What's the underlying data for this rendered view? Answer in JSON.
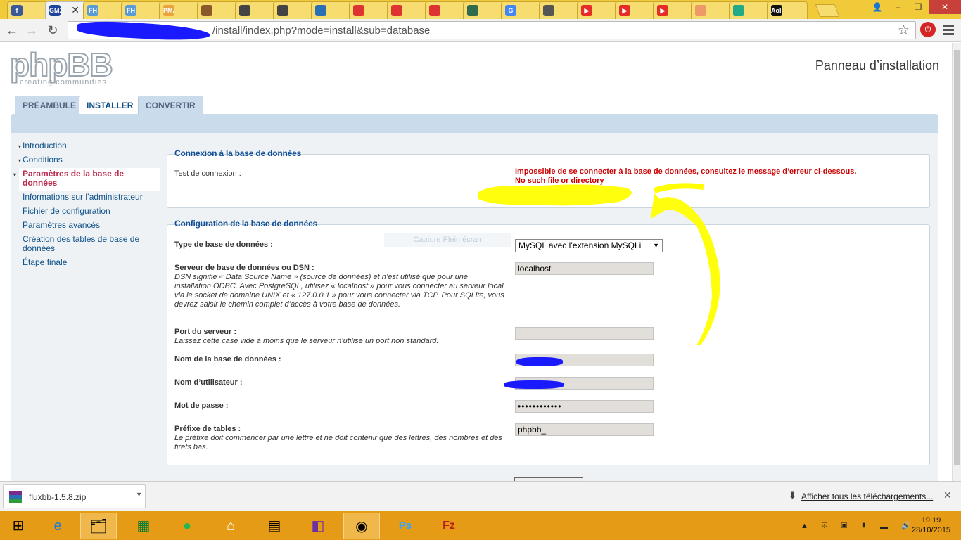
{
  "browser": {
    "tabs": [
      {
        "icon": "facebook-icon",
        "text": "f",
        "color": "#3b5998"
      },
      {
        "icon": "gmx-icon",
        "text": "GMX",
        "color": "#1c449b",
        "active": true
      },
      {
        "icon": "fh-icon",
        "text": "FH",
        "color": "#5b9bd5"
      },
      {
        "icon": "fh-icon",
        "text": "FH",
        "color": "#5b9bd5"
      },
      {
        "icon": "pma-icon",
        "text": "PMA",
        "color": "#e8a33d"
      },
      {
        "icon": "bird-icon",
        "text": "",
        "color": "#8b5a2b"
      },
      {
        "icon": "swirl-icon",
        "text": "",
        "color": "#444"
      },
      {
        "icon": "swirl-icon",
        "text": "",
        "color": "#444"
      },
      {
        "icon": "globe-icon",
        "text": "",
        "color": "#2a6fb6"
      },
      {
        "icon": "magnet-icon",
        "text": "",
        "color": "#d33"
      },
      {
        "icon": "magnet-icon",
        "text": "",
        "color": "#d33"
      },
      {
        "icon": "magnet-icon",
        "text": "",
        "color": "#d33"
      },
      {
        "icon": "camera-icon",
        "text": "",
        "color": "#2e6b4f"
      },
      {
        "icon": "google-icon",
        "text": "G",
        "color": "#4285f4"
      },
      {
        "icon": "wolf-icon",
        "text": "",
        "color": "#555"
      },
      {
        "icon": "youtube-icon",
        "text": "▶",
        "color": "#e52d27"
      },
      {
        "icon": "youtube-icon",
        "text": "▶",
        "color": "#e52d27"
      },
      {
        "icon": "youtube-icon",
        "text": "▶",
        "color": "#e52d27"
      },
      {
        "icon": "rainbow-icon",
        "text": "",
        "color": "#e96"
      },
      {
        "icon": "dial-icon",
        "text": "",
        "color": "#2a8"
      },
      {
        "icon": "aol-icon",
        "text": "Aol.",
        "color": "#111"
      }
    ],
    "url": "/install/index.php?mode=install&sub=database"
  },
  "header": {
    "logo_text": "phpBB",
    "logo_sub": "creating communities",
    "title": "Panneau d’installation"
  },
  "tabs": [
    "PRÉAMBULE",
    "INSTALLER",
    "CONVERTIR"
  ],
  "menu": [
    {
      "label": "Introduction",
      "active": false,
      "bullet": true
    },
    {
      "label": "Conditions",
      "active": false,
      "bullet": true
    },
    {
      "label": "Paramètres de la base de données",
      "active": true,
      "bullet": true
    },
    {
      "label": "Informations sur l’administrateur",
      "active": false,
      "bullet": false
    },
    {
      "label": "Fichier de configuration",
      "active": false,
      "bullet": false
    },
    {
      "label": "Paramètres avancés",
      "active": false,
      "bullet": false
    },
    {
      "label": "Création des tables de base de données",
      "active": false,
      "bullet": false
    },
    {
      "label": "Étape finale",
      "active": false,
      "bullet": false
    }
  ],
  "connection": {
    "heading": "Connexion à la base de données",
    "test_label": "Test de connexion :",
    "error_line1": "Impossible de se connecter à la base de données, consultez le message d’erreur ci-dessous.",
    "error_line2": "No such file or directory"
  },
  "config": {
    "heading": "Configuration de la base de données",
    "overlay_text": "Capture Plein écran",
    "db_type_label": "Type de base de données :",
    "db_type_value": "MySQL avec l’extension MySQLi",
    "server_label": "Serveur de base de données ou DSN :",
    "server_desc": "DSN signifie « Data Source Name » (source de données) et n’est utilisé que pour une installation ODBC. Avec PostgreSQL, utilisez « localhost » pour vous connecter au serveur local via le socket de domaine UNIX et « 127.0.0.1 » pour vous connecter via TCP. Pour SQLite, vous devrez saisir le chemin complet d’accès à votre base de données.",
    "server_value": "localhost",
    "port_label": "Port du serveur :",
    "port_desc": "Laissez cette case vide à moins que le serveur n’utilise un port non standard.",
    "port_value": "",
    "dbname_label": "Nom de la base de données :",
    "user_label": "Nom d’utilisateur :",
    "password_label": "Mot de passe :",
    "password_value": "••••••••••••",
    "prefix_label": "Préfixe de tables :",
    "prefix_desc": "Le préfixe doit commencer par une lettre et ne doit contenir que des lettres, des nombres et des tirets bas.",
    "prefix_value": "phpbb_"
  },
  "downloads": {
    "file": "fluxbb-1.5.8.zip",
    "show_all": "Afficher tous les téléchargements..."
  },
  "taskbar": {
    "time": "19:19",
    "date": "28/10/2015"
  },
  "colors": {
    "accent": "#105289",
    "error": "#cc0000",
    "highlight": "#ffff00",
    "redaction": "#1a1aff"
  }
}
